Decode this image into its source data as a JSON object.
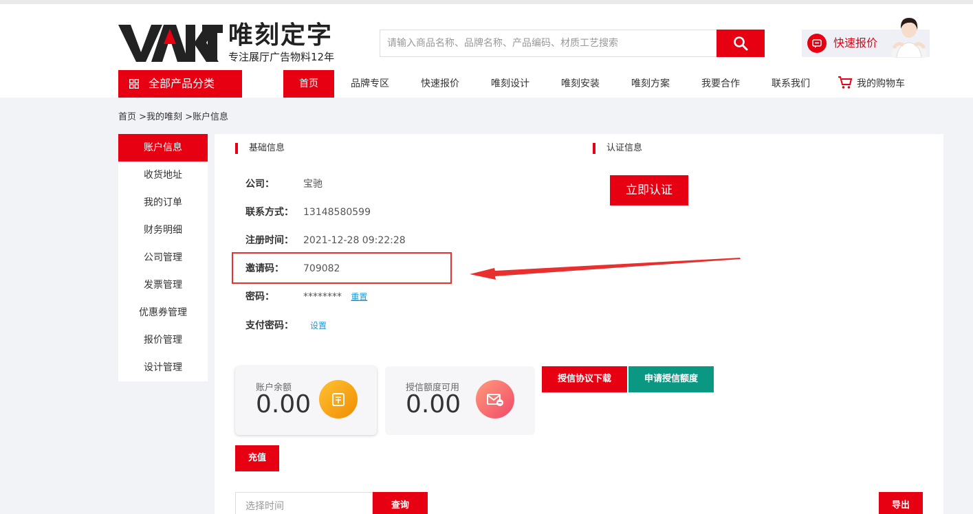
{
  "brand": {
    "logo_text": "VAKT",
    "name": "唯刻定字",
    "tagline": "专注展厅广告物料12年"
  },
  "search": {
    "placeholder": "请输入商品名称、品牌名称、产品编码、材质工艺搜索",
    "icon": "search-icon"
  },
  "quick_quote": {
    "label": "快速报价",
    "icon": "chat-icon"
  },
  "nav": {
    "all_categories": "全部产品分类",
    "items": [
      "首页",
      "品牌专区",
      "快速报价",
      "唯刻设计",
      "唯刻安装",
      "唯刻方案",
      "我要合作",
      "联系我们"
    ],
    "cart": "我的购物车",
    "active_index": 0
  },
  "breadcrumb": "首页 >我的唯刻 >账户信息",
  "sidebar": {
    "items": [
      "账户信息",
      "收货地址",
      "我的订单",
      "财务明细",
      "公司管理",
      "发票管理",
      "优惠券管理",
      "报价管理",
      "设计管理"
    ],
    "active_index": 0
  },
  "basic_info": {
    "title": "基础信息",
    "company_label": "公司：",
    "company_value": "宝驰",
    "contact_label": "联系方式：",
    "contact_value": "13148580599",
    "register_label": "注册时间：",
    "register_value": "2021-12-28 09:22:28",
    "invite_label": "邀请码：",
    "invite_value": "709082",
    "password_label": "密码：",
    "password_value": "********",
    "password_reset": "重置",
    "paypwd_label": "支付密码：",
    "paypwd_set": "设置"
  },
  "certification": {
    "title": "认证信息",
    "button": "立即认证"
  },
  "balance": {
    "label": "账户余额",
    "value": "0.00",
    "icon": "wallet-icon"
  },
  "credit": {
    "label": "授信额度可用",
    "value": "0.00",
    "icon": "envelope-icon"
  },
  "buttons": {
    "credit_download": "授信协议下载",
    "apply_credit": "申请授信额度",
    "recharge": "充值",
    "query": "查询",
    "export": "导出"
  },
  "date_filter": {
    "placeholder": "选择时间"
  },
  "colors": {
    "brand_red": "#e60012",
    "teal": "#0a9883",
    "link": "#1a9ad6"
  }
}
